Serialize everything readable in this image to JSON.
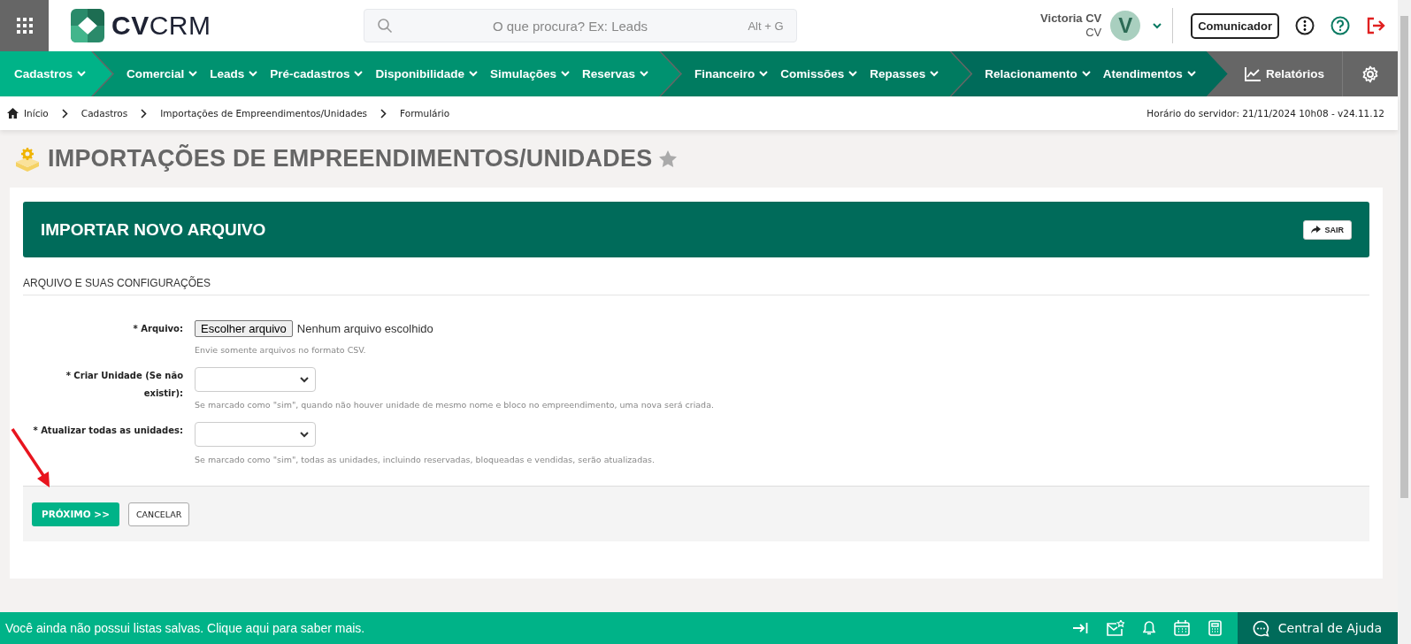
{
  "header": {
    "logo": "**CV**CRM",
    "search": {
      "placeholder": "O que procura? Ex: Leads",
      "shortcut": "Alt + G"
    },
    "user": {
      "name": "Victoria CV",
      "role": "CV",
      "initial": "V"
    },
    "communicator_button": "Comunicador"
  },
  "nav": {
    "groups": [
      {
        "color": "#00b388",
        "items": [
          "Cadastros"
        ]
      },
      {
        "color": "#009270",
        "items": [
          "Comercial",
          "Leads",
          "Pré-cadastros",
          "Disponibilidade",
          "Simulações",
          "Reservas"
        ]
      },
      {
        "color": "#007b60",
        "items": [
          "Financeiro",
          "Comissões",
          "Repasses"
        ]
      },
      {
        "color": "#006b5a",
        "items": [
          "Relacionamento",
          "Atendimentos"
        ]
      }
    ],
    "reports": "Relatórios"
  },
  "breadcrumb": {
    "items": [
      "Início",
      "Cadastros",
      "Importações de Empreendimentos/Unidades",
      "Formulário"
    ],
    "server_time": "Horário do servidor: 21/11/2024 10h08 - v24.11.12"
  },
  "page_title": "IMPORTAÇÕES DE EMPREENDIMENTOS/UNIDADES",
  "favorite": false,
  "card": {
    "title": "IMPORTAR NOVO ARQUIVO",
    "exit_button": "SAIR",
    "section_title": "ARQUIVO E SUAS CONFIGURAÇÕES",
    "fields": [
      {
        "kind": "file",
        "label": "* Arquivo:",
        "button": "Escolher arquivo",
        "value": "Nenhum arquivo escolhido",
        "help": "Envie somente arquivos no formato CSV."
      },
      {
        "kind": "select",
        "label": "* Criar Unidade (Se não existir):",
        "help": "Se marcado como \"sim\", quando não houver unidade de mesmo nome e bloco no empreendimento, uma nova será criada."
      },
      {
        "kind": "select",
        "label": "* Atualizar todas as unidades:",
        "help": "Se marcado como \"sim\", todas as unidades, incluindo reservadas, bloqueadas e vendidas, serão atualizadas."
      }
    ],
    "next_button": "PRÓXIMO >>",
    "cancel_button": "CANCELAR"
  },
  "footer": {
    "message": "Você ainda não possui listas salvas. Clique aqui para saber mais.",
    "help": "Central de Ajuda"
  }
}
